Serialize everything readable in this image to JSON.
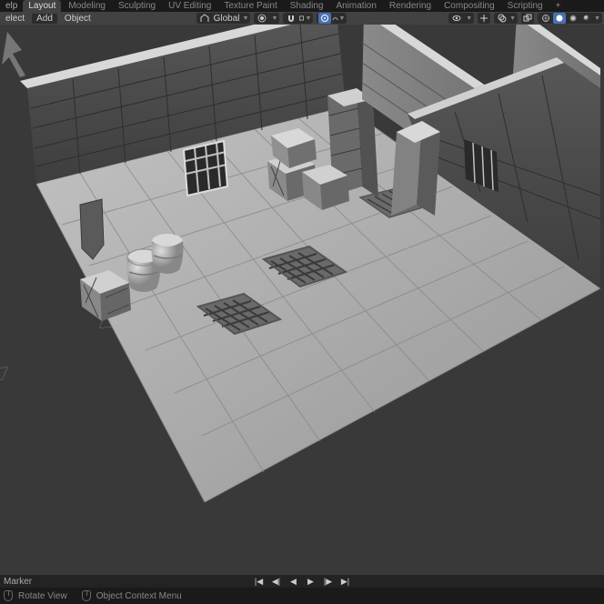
{
  "tabs_bar": {
    "help": "elp",
    "items": [
      "Layout",
      "Modeling",
      "Sculpting",
      "UV Editing",
      "Texture Paint",
      "Shading",
      "Animation",
      "Rendering",
      "Compositing",
      "Scripting"
    ],
    "active": "Layout",
    "plus": "+"
  },
  "header": {
    "left_menus": [
      "elect",
      "Add",
      "Object"
    ],
    "orientation_label": "Global",
    "orientation_icon": "orientation-icon",
    "snap_icon": "magnet-icon",
    "proportional_icon": "proportional-icon"
  },
  "viewport": {
    "scene_description": "3D isometric dungeon floor with stone tiles, walls, crates, barrels, and grates (grayscale matcap shading)"
  },
  "timeline": {
    "marker_label": "Marker"
  },
  "status": {
    "hint1": "Rotate View",
    "hint2": "Object Context Menu"
  },
  "colors": {
    "bg": "#393939",
    "panel": "#424242",
    "dark": "#1a1a1a",
    "accent": "#4772b3"
  }
}
